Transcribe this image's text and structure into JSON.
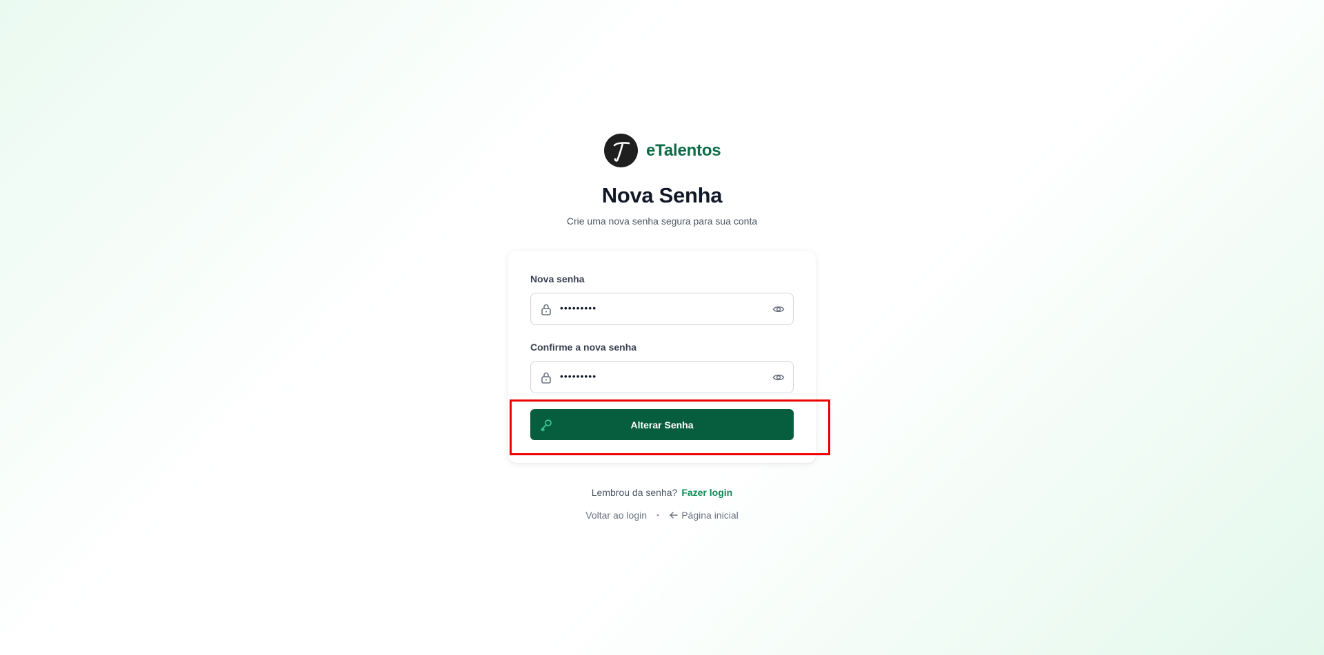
{
  "brand": {
    "name": "eTalentos",
    "logo_letter": "T"
  },
  "header": {
    "title": "Nova Senha",
    "subtitle": "Crie uma nova senha segura para sua conta"
  },
  "form": {
    "new_password": {
      "label": "Nova senha",
      "value": "•••••••••",
      "icon": "lock-icon",
      "toggle_icon": "eye-icon"
    },
    "confirm_password": {
      "label": "Confirme a nova senha",
      "value": "•••••••••",
      "icon": "lock-icon",
      "toggle_icon": "eye-icon"
    },
    "submit": {
      "label": "Alterar Senha",
      "icon": "key-icon"
    }
  },
  "footer": {
    "remember_text": "Lembrou da senha?",
    "login_link": "Fazer login",
    "back_to_login": "Voltar ao login",
    "separator": "•",
    "home_link": "Página inicial"
  },
  "colors": {
    "brand_green": "#0d6b47",
    "button_green": "#075e3f",
    "link_green": "#0f8a55",
    "highlight_red": "#ee0000"
  }
}
